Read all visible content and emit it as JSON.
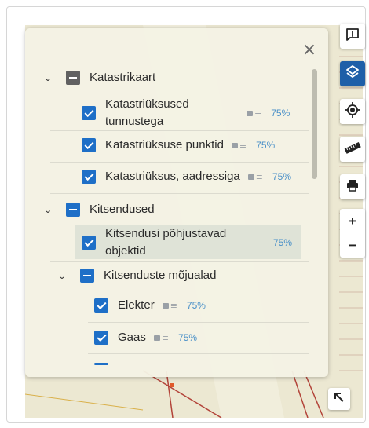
{
  "panel": {
    "close_label": "×",
    "groups": [
      {
        "label": "Katastrikaart",
        "state": "partial",
        "items": [
          {
            "label_line1": "Katastriüksused",
            "label_line2": "tunnustega",
            "opacity": "75%"
          },
          {
            "label": "Katastriüksuse punktid",
            "opacity": "75%"
          },
          {
            "label": "Katastriüksus, aadressiga",
            "opacity": "75%"
          }
        ]
      },
      {
        "label": "Kitsendused",
        "state": "partial",
        "items": [
          {
            "label_line1": "Kitsendusi põhjustavad",
            "label_line2": "objektid",
            "opacity": "75%"
          }
        ],
        "subgroups": [
          {
            "label": "Kitsenduste mõjualad",
            "state": "partial",
            "items": [
              {
                "label": "Elekter",
                "opacity": "75%"
              },
              {
                "label": "Gaas",
                "opacity": "75%"
              }
            ]
          }
        ]
      }
    ]
  },
  "toolbar": {
    "buttons": [
      {
        "icon": "feedback-icon"
      },
      {
        "icon": "layers-icon",
        "active": true
      },
      {
        "icon": "locate-icon"
      },
      {
        "icon": "ruler-icon"
      },
      {
        "icon": "print-icon"
      }
    ],
    "zoom_in_label": "+",
    "zoom_out_label": "−"
  },
  "colors": {
    "accent": "#1e6fc7",
    "active_tool": "#1e5fa8",
    "percent_text": "#4a90c8",
    "map_bg": "#ece8d2",
    "map_line": "#c0392b"
  }
}
